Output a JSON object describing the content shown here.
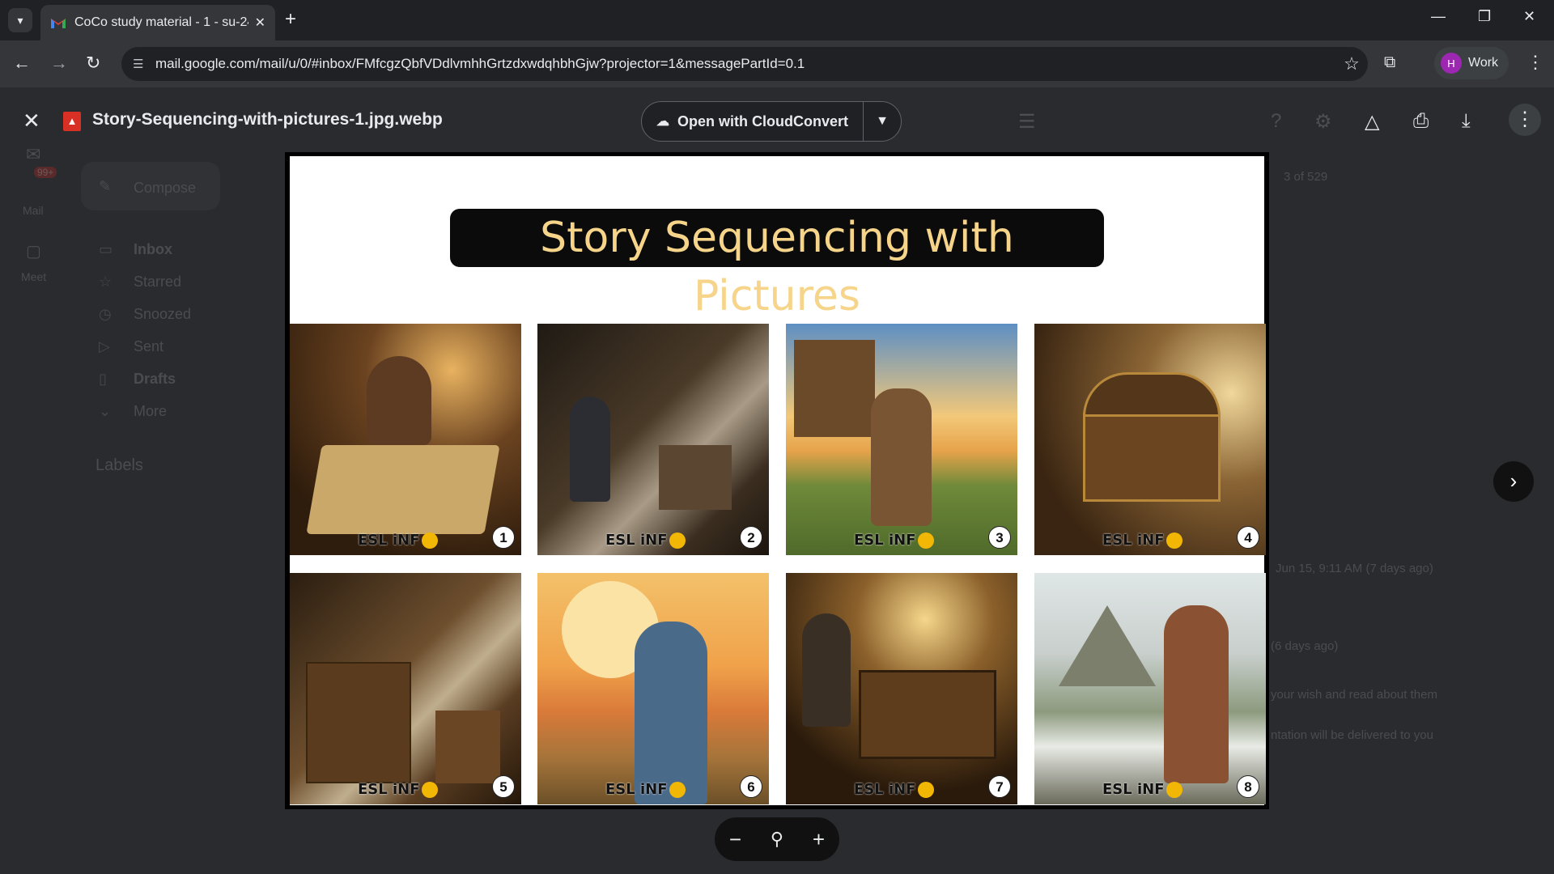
{
  "browser": {
    "tab_title": "CoCo study material - 1 - su-24",
    "url": "mail.google.com/mail/u/0/#inbox/FMfcgzQbfVDdlvmhhGrtzdxwdqhbhGjw?projector=1&messagePartId=0.1",
    "profile_label": "Work",
    "profile_initial": "H"
  },
  "gmail": {
    "rail_mail": "Mail",
    "rail_badge": "99+",
    "rail_meet": "Meet",
    "compose": "Compose",
    "nav": [
      "Inbox",
      "Starred",
      "Snoozed",
      "Sent",
      "Drafts",
      "More"
    ],
    "labels_heading": "Labels",
    "pager": "3 of 529",
    "date_text": "Jun 15, 9:11 AM (7 days ago)",
    "date_text_2": "(6 days ago)",
    "snippet_1": "your wish and read about them",
    "snippet_2": "ntation will be delivered to you"
  },
  "viewer": {
    "file_name": "Story-Sequencing-with-pictures-1.jpg.webp",
    "open_with_label": "Open with CloudConvert"
  },
  "image": {
    "banner_title": "Story Sequencing with Pictures",
    "logo_text": "ESL iNF",
    "panel_numbers": [
      "1",
      "2",
      "3",
      "4",
      "5",
      "6",
      "7",
      "8"
    ]
  },
  "colors": {
    "banner_text": "#f6d58b",
    "viewer_overlay": "#202124",
    "logo_accent": "#f2b705"
  }
}
